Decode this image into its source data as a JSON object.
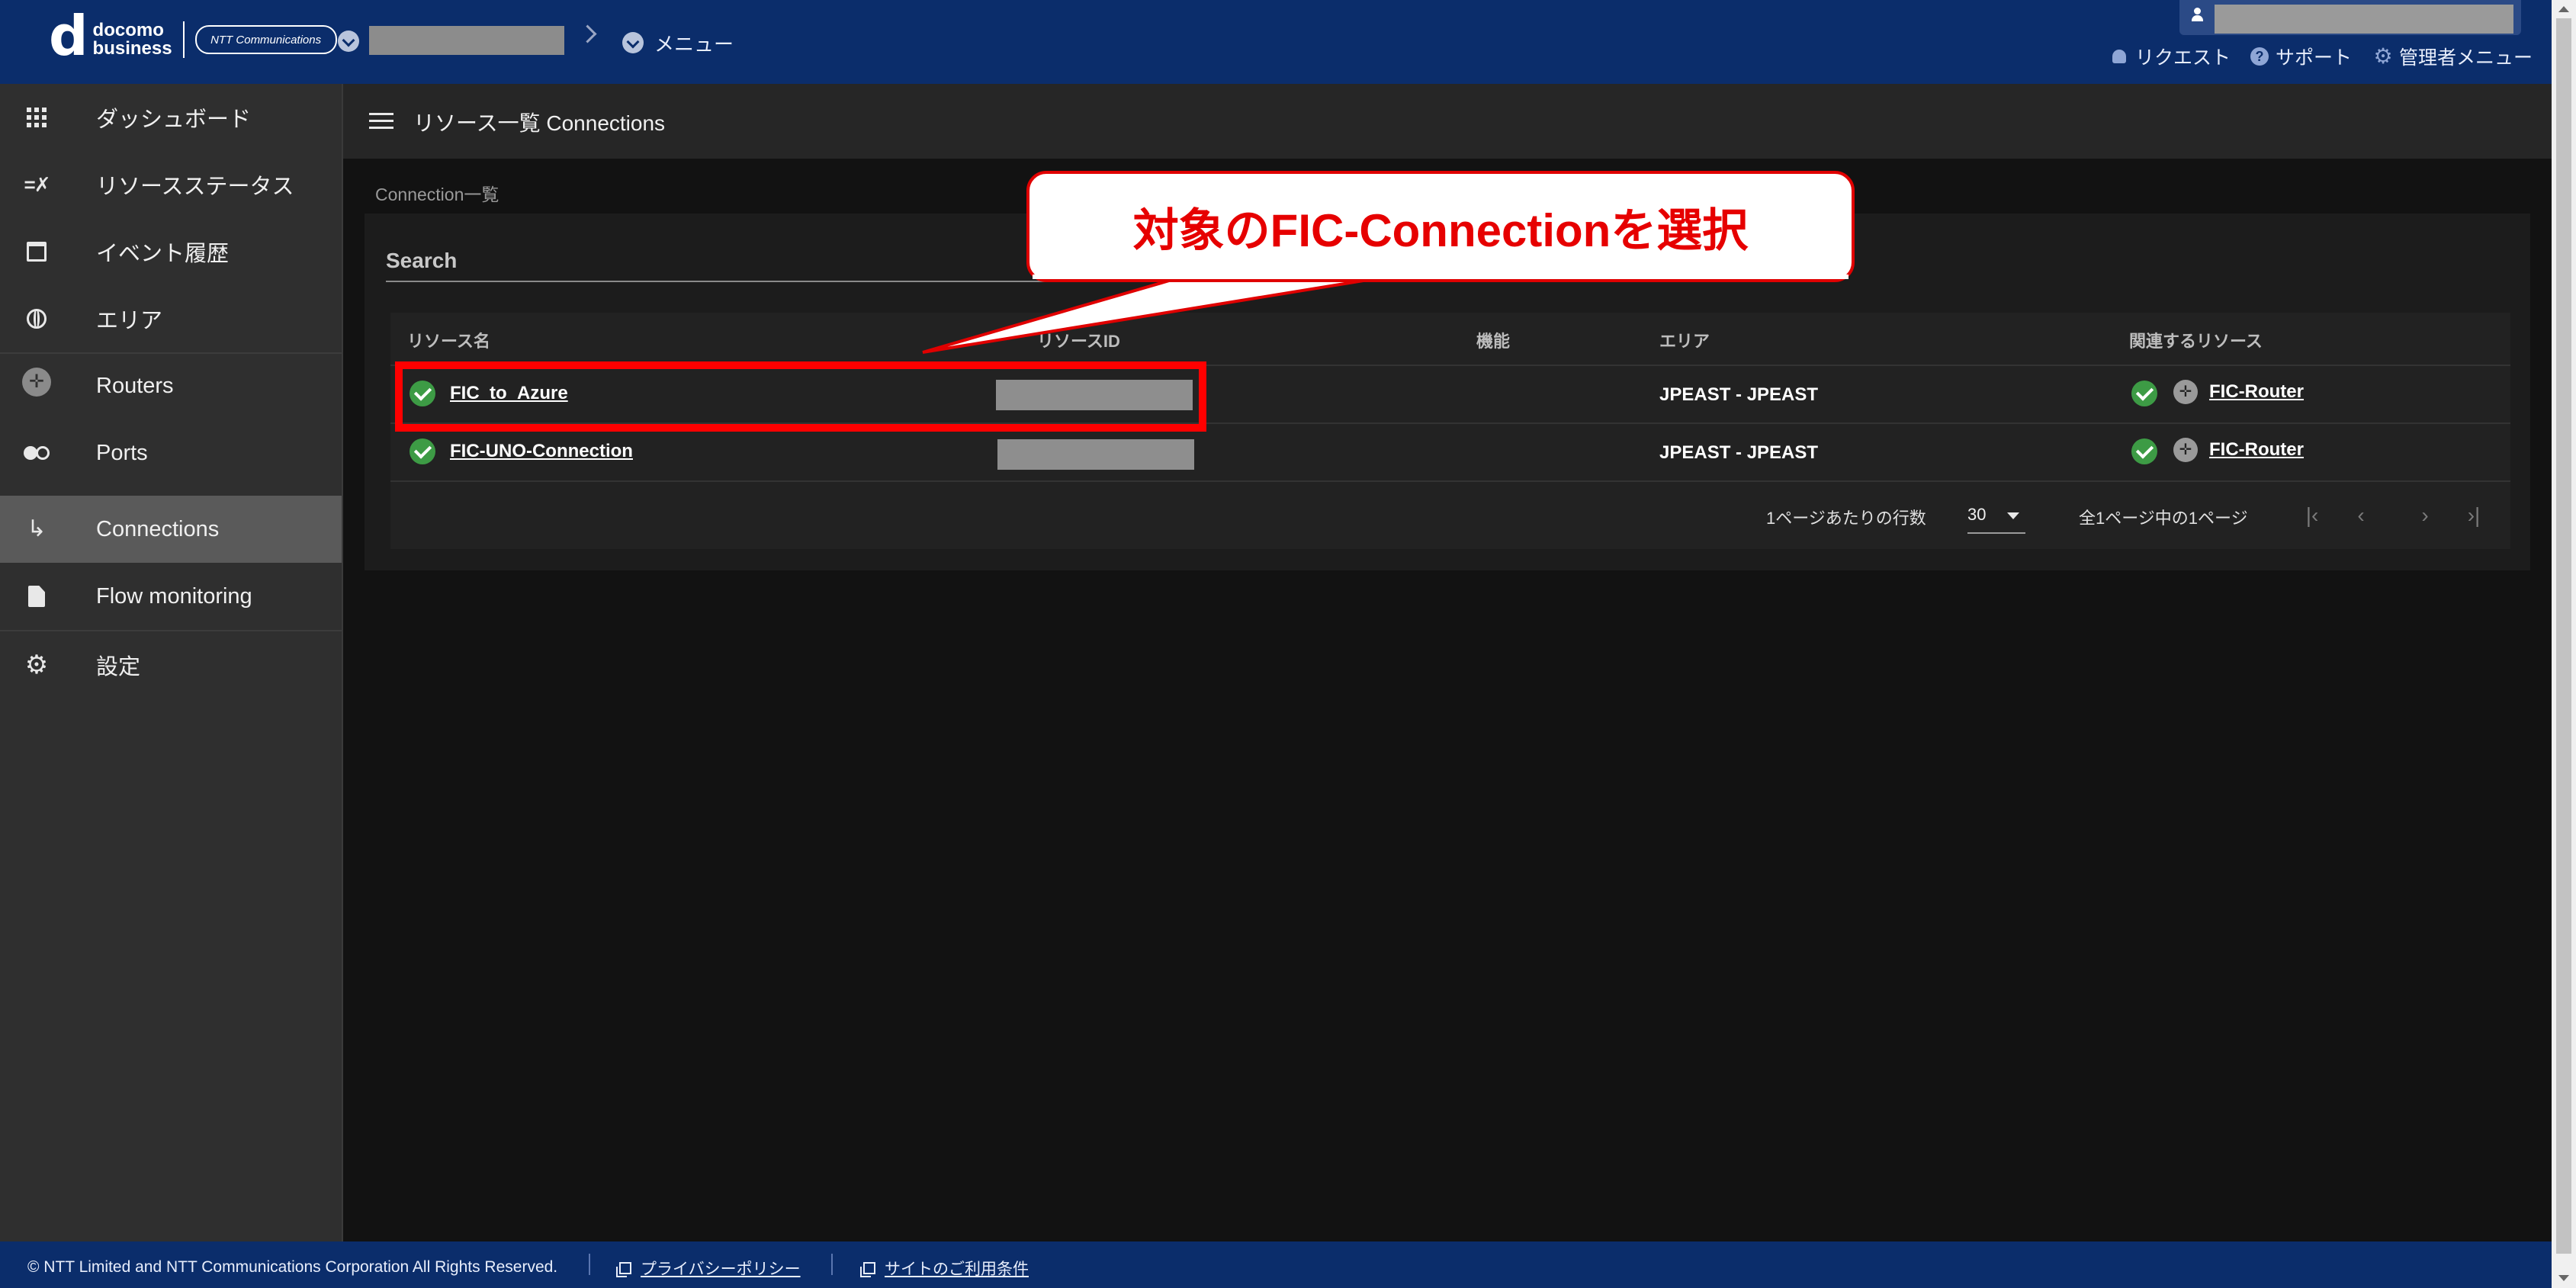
{
  "header": {
    "logo_d": "d",
    "logo_line1": "docomo",
    "logo_line2": "business",
    "ntt_logo": "NTT Communications",
    "breadcrumb_menu": "メニュー",
    "links": {
      "request": "リクエスト",
      "support": "サポート",
      "admin_menu": "管理者メニュー"
    }
  },
  "sidebar": {
    "items": [
      {
        "label": "ダッシュボード",
        "icon": "dashboard-icon"
      },
      {
        "label": "リソースステータス",
        "icon": "resource-status-icon"
      },
      {
        "label": "イベント履歴",
        "icon": "calendar-icon"
      },
      {
        "label": "エリア",
        "icon": "globe-icon"
      },
      {
        "label": "Routers",
        "icon": "router-icon"
      },
      {
        "label": "Ports",
        "icon": "ports-icon"
      },
      {
        "label": "Connections",
        "icon": "connection-icon",
        "active": true
      },
      {
        "label": "Flow monitoring",
        "icon": "document-icon"
      },
      {
        "label": "設定",
        "icon": "gear-icon"
      }
    ]
  },
  "main": {
    "title": "リソース一覧 Connections",
    "section_label": "Connection一覧",
    "search_label": "Search",
    "table": {
      "headers": [
        "リソース名",
        "リソースID",
        "機能",
        "エリア",
        "関連するリソース"
      ],
      "rows": [
        {
          "status": "ok",
          "name": "FIC_to_Azure",
          "area": "JPEAST - JPEAST",
          "related": "FIC-Router"
        },
        {
          "status": "ok",
          "name": "FIC-UNO-Connection",
          "area": "JPEAST - JPEAST",
          "related": "FIC-Router"
        }
      ]
    },
    "pagination": {
      "rows_per_page_label": "1ページあたりの行数",
      "rows_per_page_value": "30",
      "page_info": "全1ページ中の1ページ",
      "first": "|‹",
      "prev": "‹",
      "next": "›",
      "last": "›|"
    }
  },
  "annotation": {
    "callout_text": "対象のFIC-Connectionを選択",
    "color": "#ff0000"
  },
  "footer": {
    "copyright": "© NTT Limited and NTT Communications Corporation All Rights Reserved.",
    "privacy_link": "プライバシーポリシー",
    "terms_link": "サイトのご利用条件"
  },
  "colors": {
    "header_bg": "#0b2d6b",
    "sidebar_bg": "#2f2f2f",
    "main_bg": "#121212",
    "status_ok": "#3d9b45"
  }
}
